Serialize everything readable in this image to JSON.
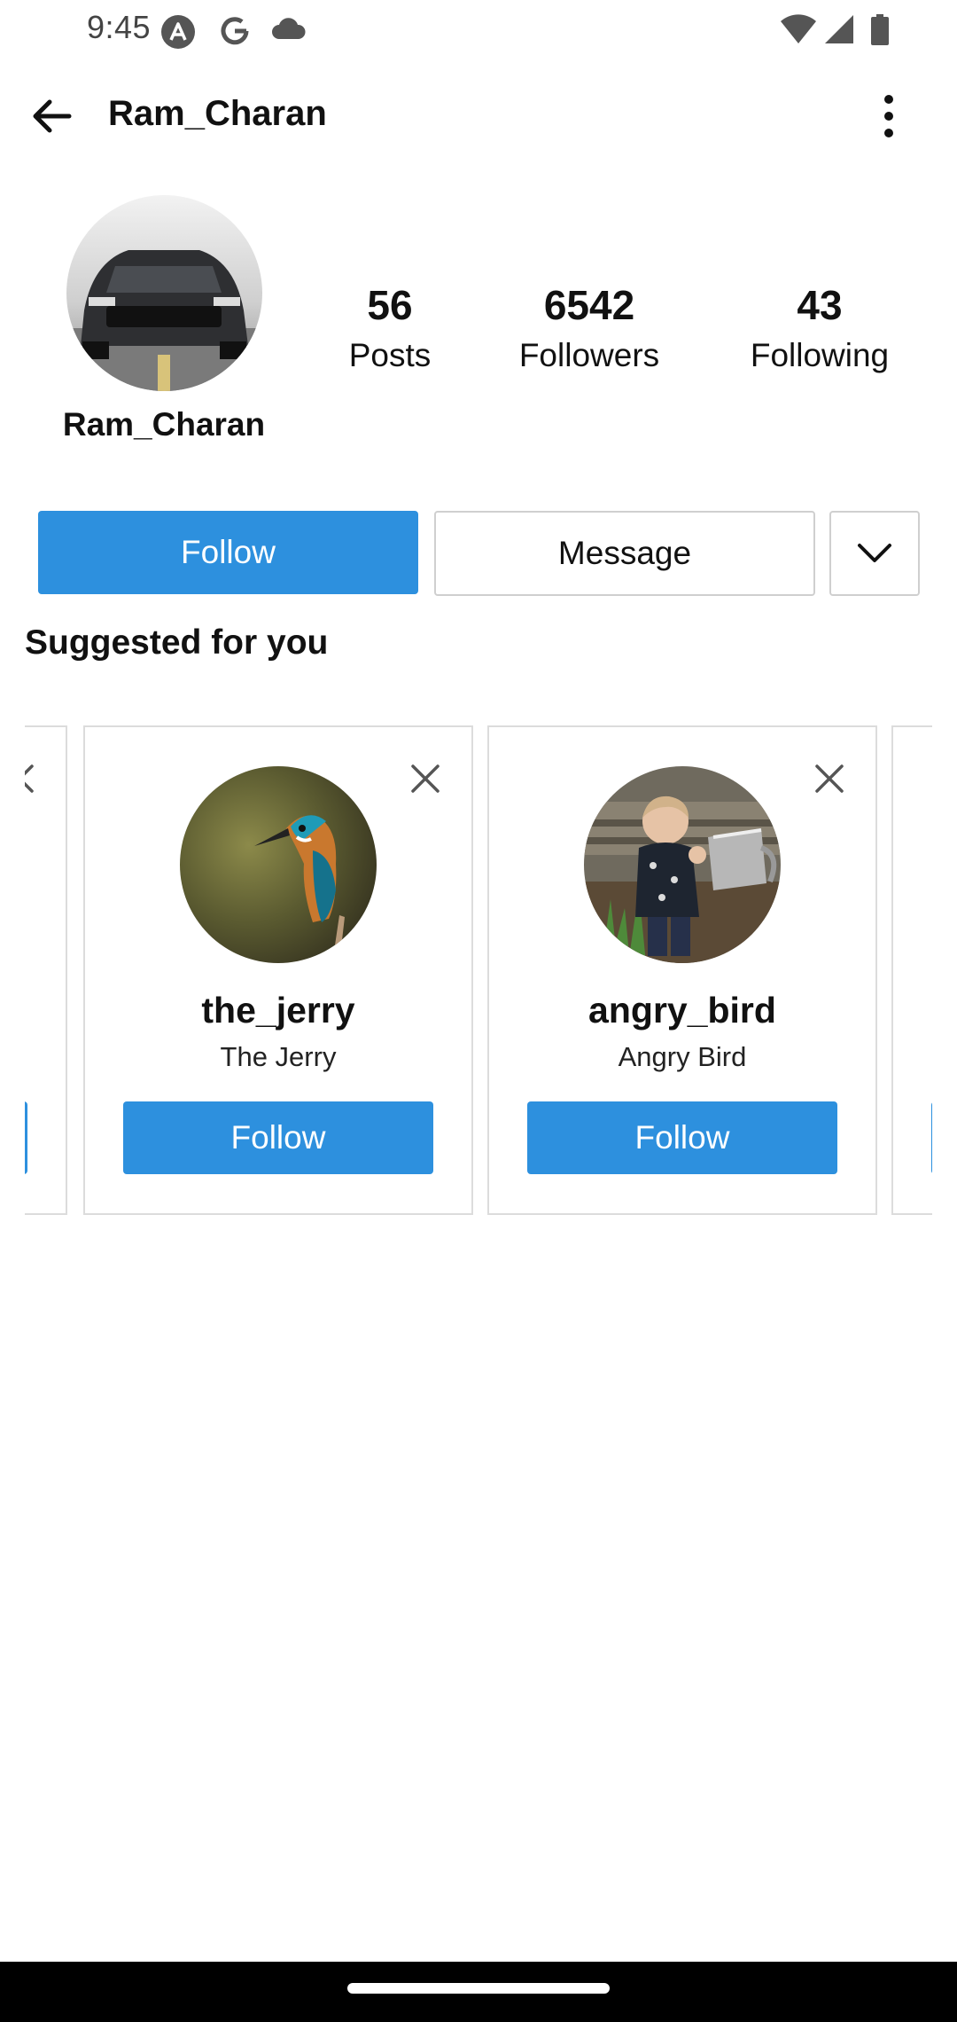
{
  "status_bar": {
    "time": "9:45",
    "icons": [
      "a-icon",
      "google-icon",
      "cloud-icon",
      "wifi-icon",
      "signal-icon",
      "battery-icon"
    ]
  },
  "app_bar": {
    "title": "Ram_Charan",
    "back_icon": "arrow-back-icon",
    "menu_icon": "more-vert-icon"
  },
  "profile": {
    "name": "Ram_Charan",
    "avatar": "car-photo",
    "stats": {
      "posts": {
        "value": "56",
        "label": "Posts"
      },
      "followers": {
        "value": "6542",
        "label": "Followers"
      },
      "following": {
        "value": "43",
        "label": "Following"
      }
    }
  },
  "actions": {
    "follow_label": "Follow",
    "message_label": "Message",
    "dropdown_icon": "chevron-down-icon"
  },
  "suggested": {
    "title": "Suggested for you",
    "cards": [
      {
        "username": "the_jerry",
        "full_name": "The Jerry",
        "follow_label": "Follow",
        "avatar": "kingfisher-photo"
      },
      {
        "username": "angry_bird",
        "full_name": "Angry Bird",
        "follow_label": "Follow",
        "avatar": "child-watering-photo"
      }
    ]
  },
  "colors": {
    "accent": "#2d90de",
    "border": "#dcdcdc",
    "nav_bar": "#000000"
  }
}
